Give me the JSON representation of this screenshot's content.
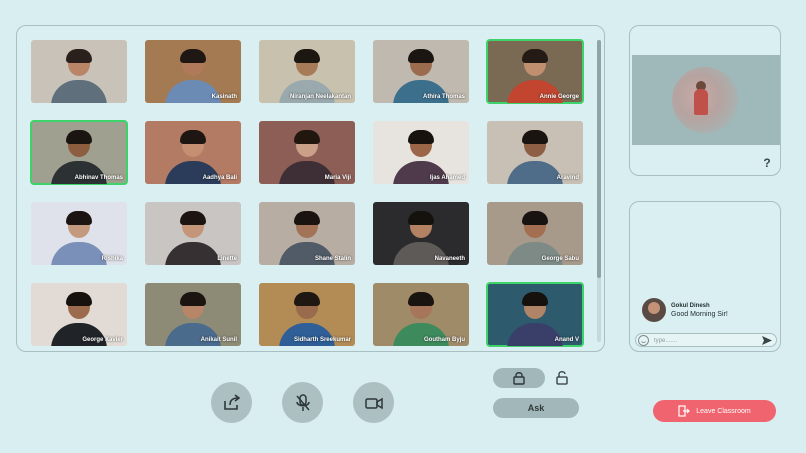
{
  "participants": [
    {
      "name": "",
      "bg": "#c9c2b8",
      "hair": "#2b211c",
      "skin": "#b98566",
      "shirt": "#5f6f7b",
      "active": false
    },
    {
      "name": "Kasinath",
      "bg": "#a47a52",
      "hair": "#1f1714",
      "skin": "#b07a5a",
      "shirt": "#6b8bb5",
      "active": false
    },
    {
      "name": "Niranjan Neelakantan",
      "bg": "#c7c1ae",
      "hair": "#1d1712",
      "skin": "#a77a58",
      "shirt": "#9aa9ad",
      "active": false
    },
    {
      "name": "Athira Thomas",
      "bg": "#bfb9b0",
      "hair": "#1c1613",
      "skin": "#9b6b4e",
      "shirt": "#3c6f8c",
      "active": false
    },
    {
      "name": "Annie George",
      "bg": "#7a6a54",
      "hair": "#241a16",
      "skin": "#c08f70",
      "shirt": "#c2452f",
      "active": true
    },
    {
      "name": "Abhinav Thomas",
      "bg": "#9fa08f",
      "hair": "#1a1511",
      "skin": "#8c5d3e",
      "shirt": "#2c3134",
      "active": true
    },
    {
      "name": "Aadhya Bali",
      "bg": "#b37a64",
      "hair": "#1d1613",
      "skin": "#c48f72",
      "shirt": "#2a3c5a",
      "active": false
    },
    {
      "name": "Maria Viji",
      "bg": "#8c5e55",
      "hair": "#21170f",
      "skin": "#caa088",
      "shirt": "#3e2f36",
      "active": false
    },
    {
      "name": "Ijas Ahamed",
      "bg": "#e7e3df",
      "hair": "#17120e",
      "skin": "#9a6647",
      "shirt": "#4e3a4a",
      "active": false
    },
    {
      "name": "Aravind",
      "bg": "#c8c0b4",
      "hair": "#1a1410",
      "skin": "#8d5f44",
      "shirt": "#4f6d88",
      "active": false
    },
    {
      "name": "Rishika",
      "bg": "#dfe2ea",
      "hair": "#1b1410",
      "skin": "#c49a7e",
      "shirt": "#7b90b8",
      "active": false
    },
    {
      "name": "Linette",
      "bg": "#c9c5c2",
      "hair": "#1c1410",
      "skin": "#c49579",
      "shirt": "#373033",
      "active": false
    },
    {
      "name": "Shane Stalin",
      "bg": "#b7ada3",
      "hair": "#1a130f",
      "skin": "#a37358",
      "shirt": "#505b67",
      "active": false
    },
    {
      "name": "Navaneeth",
      "bg": "#2b2b2d",
      "hair": "#15110d",
      "skin": "#b38263",
      "shirt": "#5d5a57",
      "active": false
    },
    {
      "name": "George Sabu",
      "bg": "#a89a8b",
      "hair": "#181310",
      "skin": "#a46f50",
      "shirt": "#7d8a86",
      "active": false
    },
    {
      "name": "George Xavier",
      "bg": "#e2dbd5",
      "hair": "#18120e",
      "skin": "#9c6a4c",
      "shirt": "#202428",
      "active": false
    },
    {
      "name": "Anikait Sunil",
      "bg": "#8d8a76",
      "hair": "#1b1410",
      "skin": "#b78567",
      "shirt": "#4a6b8c",
      "active": false
    },
    {
      "name": "Sidharth Sreekumar",
      "bg": "#b28b55",
      "hair": "#1e1712",
      "skin": "#9a6a4d",
      "shirt": "#2f5f96",
      "active": false
    },
    {
      "name": "Goutham Byju",
      "bg": "#a08b68",
      "hair": "#191410",
      "skin": "#a6755a",
      "shirt": "#3d8a5c",
      "active": false
    },
    {
      "name": "Anand V",
      "bg": "#2e5a6e",
      "hair": "#16110d",
      "skin": "#b08466",
      "shirt": "#3a3f6a",
      "active": true
    }
  ],
  "chat": {
    "sender": "Gokul Dinesh",
    "message": "Good Morning Sir!",
    "input_placeholder": "type......."
  },
  "controls": {
    "share_icon": "share-screen-icon",
    "mic_icon": "mic-off-icon",
    "camera_icon": "camera-icon"
  },
  "ask_label": "Ask",
  "leave_label": "Leave Classroom",
  "colors": {
    "background": "#d8eef0",
    "leave_button": "#f06470",
    "active_outline": "#3ed26a"
  }
}
